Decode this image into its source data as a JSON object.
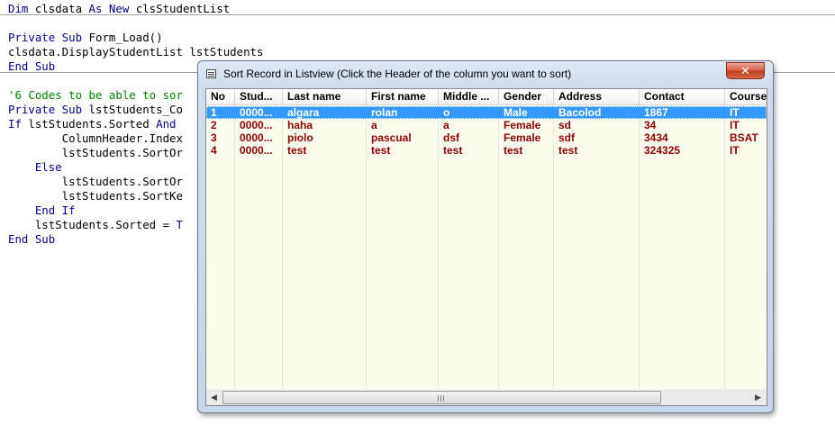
{
  "code": {
    "lines": [
      [
        {
          "t": "Dim ",
          "c": "kw"
        },
        {
          "t": "clsdata ",
          "c": ""
        },
        {
          "t": "As New ",
          "c": "kw"
        },
        {
          "t": "clsStudentList",
          "c": ""
        }
      ],
      [],
      [
        {
          "t": "Private Sub ",
          "c": "kw"
        },
        {
          "t": "Form_Load()",
          "c": ""
        }
      ],
      [
        {
          "t": "clsdata.DisplayStudentList lstStudents",
          "c": ""
        }
      ],
      [
        {
          "t": "End Sub",
          "c": "kw"
        }
      ],
      [],
      [
        {
          "t": "'6 Codes to be able to sor",
          "c": "cm"
        }
      ],
      [
        {
          "t": "Private Sub ",
          "c": "kw"
        },
        {
          "t": "lstStudents_Co",
          "c": ""
        }
      ],
      [
        {
          "t": "If ",
          "c": "kw"
        },
        {
          "t": "lstStudents.Sorted ",
          "c": ""
        },
        {
          "t": "And ",
          "c": "kw"
        }
      ],
      [
        {
          "t": "        ColumnHeader.Index",
          "c": ""
        }
      ],
      [
        {
          "t": "        lstStudents.SortOr",
          "c": ""
        }
      ],
      [
        {
          "t": "    Else",
          "c": "kw"
        }
      ],
      [
        {
          "t": "        lstStudents.SortOr",
          "c": ""
        }
      ],
      [
        {
          "t": "        lstStudents.SortKe",
          "c": ""
        }
      ],
      [
        {
          "t": "    End If",
          "c": "kw"
        }
      ],
      [
        {
          "t": "    lstStudents.Sorted = ",
          "c": ""
        },
        {
          "t": "T",
          "c": "kw"
        }
      ],
      [
        {
          "t": "End Sub",
          "c": "kw"
        }
      ]
    ]
  },
  "dialog": {
    "title": "Sort Record in Listview (Click the Header of the column you want to sort)",
    "close_label": "✕"
  },
  "listview": {
    "columns": [
      "No",
      "Stud...",
      "Last name",
      "First name",
      "Middle ...",
      "Gender",
      "Address",
      "Contact",
      "Course"
    ],
    "rows": [
      [
        "1",
        "0000...",
        "algara",
        "rolan",
        "o",
        "Male",
        "Bacolod",
        "1867",
        "IT"
      ],
      [
        "2",
        "0000...",
        "haha",
        "a",
        "a",
        "Female",
        "sd",
        "34",
        "IT"
      ],
      [
        "3",
        "0000...",
        "piolo",
        "pascual",
        "dsf",
        "Female",
        "sdf",
        "3434",
        "BSAT"
      ],
      [
        "4",
        "0000...",
        "test",
        "test",
        "test",
        "test",
        "test",
        "324325",
        "IT"
      ]
    ],
    "selected_row": 0
  },
  "scrollbar": {
    "left_arrow": "◀",
    "right_arrow": "▶"
  },
  "colors": {
    "row_text": "#8b0000",
    "selection": "#3399ff",
    "listview_bg": "#fcfcec"
  }
}
